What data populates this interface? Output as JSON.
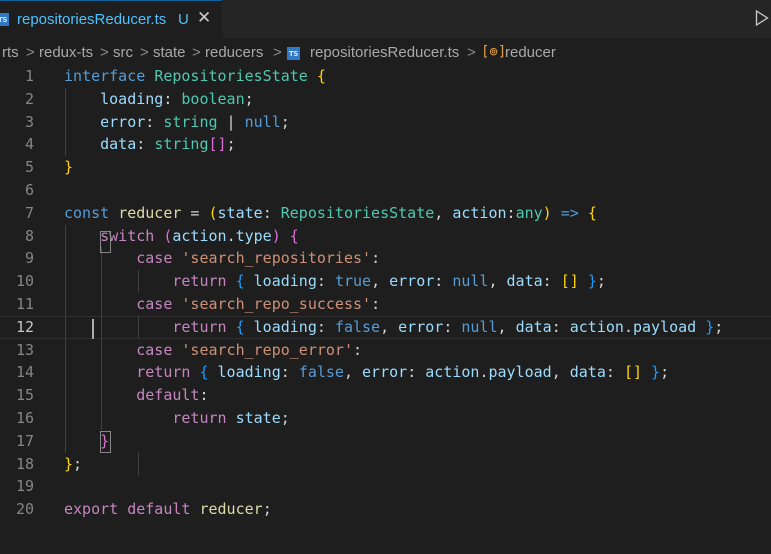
{
  "tab": {
    "title": "repositoriesReducer.ts",
    "status": "U",
    "badge": "TS",
    "close_glyph": "✕"
  },
  "breadcrumb": {
    "items": [
      "rts",
      "redux-ts",
      "src",
      "state",
      "reducers",
      "repositoriesReducer.ts",
      "reducer"
    ],
    "separator": ">",
    "file_badge": "TS",
    "symbol_glyph": "[⊚]"
  },
  "editor": {
    "line_numbers": [
      "1",
      "2",
      "3",
      "4",
      "5",
      "6",
      "7",
      "8",
      "9",
      "10",
      "11",
      "12",
      "13",
      "14",
      "15",
      "16",
      "17",
      "18",
      "19",
      "20"
    ],
    "active_line": "12",
    "lines": [
      [
        [
          "kw",
          "interface"
        ],
        [
          "pl",
          " "
        ],
        [
          "type",
          "RepositoriesState"
        ],
        [
          "pl",
          " "
        ],
        [
          "br1",
          "{"
        ]
      ],
      [
        [
          "pl",
          "    "
        ],
        [
          "var",
          "loading"
        ],
        [
          "pl",
          ": "
        ],
        [
          "type",
          "boolean"
        ],
        [
          "pl",
          ";"
        ]
      ],
      [
        [
          "pl",
          "    "
        ],
        [
          "var",
          "error"
        ],
        [
          "pl",
          ": "
        ],
        [
          "type",
          "string"
        ],
        [
          "pl",
          " | "
        ],
        [
          "kw",
          "null"
        ],
        [
          "pl",
          ";"
        ]
      ],
      [
        [
          "pl",
          "    "
        ],
        [
          "var",
          "data"
        ],
        [
          "pl",
          ": "
        ],
        [
          "type",
          "string"
        ],
        [
          "br2",
          "[]"
        ],
        [
          "pl",
          ";"
        ]
      ],
      [
        [
          "br1",
          "}"
        ]
      ],
      [],
      [
        [
          "kw",
          "const"
        ],
        [
          "pl",
          " "
        ],
        [
          "fn",
          "reducer"
        ],
        [
          "pl",
          " = "
        ],
        [
          "br1",
          "("
        ],
        [
          "var",
          "state"
        ],
        [
          "pl",
          ": "
        ],
        [
          "type",
          "RepositoriesState"
        ],
        [
          "pl",
          ", "
        ],
        [
          "var",
          "action"
        ],
        [
          "pl",
          ":"
        ],
        [
          "type",
          "any"
        ],
        [
          "br1",
          ")"
        ],
        [
          "pl",
          " "
        ],
        [
          "kw",
          "=>"
        ],
        [
          "pl",
          " "
        ],
        [
          "br1",
          "{"
        ]
      ],
      [
        [
          "pl",
          "    "
        ],
        [
          "ctl",
          "switch"
        ],
        [
          "pl",
          " "
        ],
        [
          "br2",
          "("
        ],
        [
          "var",
          "action"
        ],
        [
          "pl",
          "."
        ],
        [
          "var",
          "type"
        ],
        [
          "br2",
          ")"
        ],
        [
          "pl",
          " "
        ],
        [
          "br2",
          "{"
        ]
      ],
      [
        [
          "pl",
          "        "
        ],
        [
          "ctl",
          "case"
        ],
        [
          "pl",
          " "
        ],
        [
          "str",
          "'search_repositories'"
        ],
        [
          "pl",
          ":"
        ]
      ],
      [
        [
          "pl",
          "            "
        ],
        [
          "ctl",
          "return"
        ],
        [
          "pl",
          " "
        ],
        [
          "br3",
          "{"
        ],
        [
          "pl",
          " "
        ],
        [
          "var",
          "loading"
        ],
        [
          "pl",
          ": "
        ],
        [
          "kw",
          "true"
        ],
        [
          "pl",
          ", "
        ],
        [
          "var",
          "error"
        ],
        [
          "pl",
          ": "
        ],
        [
          "kw",
          "null"
        ],
        [
          "pl",
          ", "
        ],
        [
          "var",
          "data"
        ],
        [
          "pl",
          ": "
        ],
        [
          "br1",
          "[]"
        ],
        [
          "pl",
          " "
        ],
        [
          "br3",
          "}"
        ],
        [
          "pl",
          ";"
        ]
      ],
      [
        [
          "pl",
          "        "
        ],
        [
          "ctl",
          "case"
        ],
        [
          "pl",
          " "
        ],
        [
          "str",
          "'search_repo_success'"
        ],
        [
          "pl",
          ":"
        ]
      ],
      [
        [
          "pl",
          "            "
        ],
        [
          "ctl",
          "return"
        ],
        [
          "pl",
          " "
        ],
        [
          "br3",
          "{"
        ],
        [
          "pl",
          " "
        ],
        [
          "var",
          "loading"
        ],
        [
          "pl",
          ": "
        ],
        [
          "kw",
          "false"
        ],
        [
          "pl",
          ", "
        ],
        [
          "var",
          "error"
        ],
        [
          "pl",
          ": "
        ],
        [
          "kw",
          "null"
        ],
        [
          "pl",
          ", "
        ],
        [
          "var",
          "data"
        ],
        [
          "pl",
          ": "
        ],
        [
          "var",
          "action"
        ],
        [
          "pl",
          "."
        ],
        [
          "var",
          "payload"
        ],
        [
          "pl",
          " "
        ],
        [
          "br3",
          "}"
        ],
        [
          "pl",
          ";"
        ]
      ],
      [
        [
          "pl",
          "        "
        ],
        [
          "ctl",
          "case"
        ],
        [
          "pl",
          " "
        ],
        [
          "str",
          "'search_repo_error'"
        ],
        [
          "pl",
          ":"
        ]
      ],
      [
        [
          "pl",
          "        "
        ],
        [
          "ctl",
          "return"
        ],
        [
          "pl",
          " "
        ],
        [
          "br3",
          "{"
        ],
        [
          "pl",
          " "
        ],
        [
          "var",
          "loading"
        ],
        [
          "pl",
          ": "
        ],
        [
          "kw",
          "false"
        ],
        [
          "pl",
          ", "
        ],
        [
          "var",
          "error"
        ],
        [
          "pl",
          ": "
        ],
        [
          "var",
          "action"
        ],
        [
          "pl",
          "."
        ],
        [
          "var",
          "payload"
        ],
        [
          "pl",
          ", "
        ],
        [
          "var",
          "data"
        ],
        [
          "pl",
          ": "
        ],
        [
          "br1",
          "[]"
        ],
        [
          "pl",
          " "
        ],
        [
          "br3",
          "}"
        ],
        [
          "pl",
          ";"
        ]
      ],
      [
        [
          "pl",
          "        "
        ],
        [
          "ctl",
          "default"
        ],
        [
          "pl",
          ":"
        ]
      ],
      [
        [
          "pl",
          "            "
        ],
        [
          "ctl",
          "return"
        ],
        [
          "pl",
          " "
        ],
        [
          "var",
          "state"
        ],
        [
          "pl",
          ";"
        ]
      ],
      [
        [
          "pl",
          "    "
        ],
        [
          "br2",
          "}"
        ]
      ],
      [
        [
          "br1",
          "}"
        ],
        [
          "pl",
          ";"
        ]
      ],
      [],
      [
        [
          "ctl",
          "export"
        ],
        [
          "pl",
          " "
        ],
        [
          "ctl",
          "default"
        ],
        [
          "pl",
          " "
        ],
        [
          "fn",
          "reducer"
        ],
        [
          "pl",
          ";"
        ]
      ]
    ]
  },
  "colors": {
    "kw": "#569cd6",
    "ctl": "#c586c0",
    "type": "#4ec9b0",
    "str": "#ce9178",
    "var": "#9cdcfe",
    "fn": "#dcdcaa",
    "br1": "#ffd700",
    "br2": "#da70d6",
    "br3": "#179fff",
    "editor_bg": "#1e1e1e",
    "tab_accent": "#4fc1ff",
    "ts_badge": "#3178c6"
  }
}
